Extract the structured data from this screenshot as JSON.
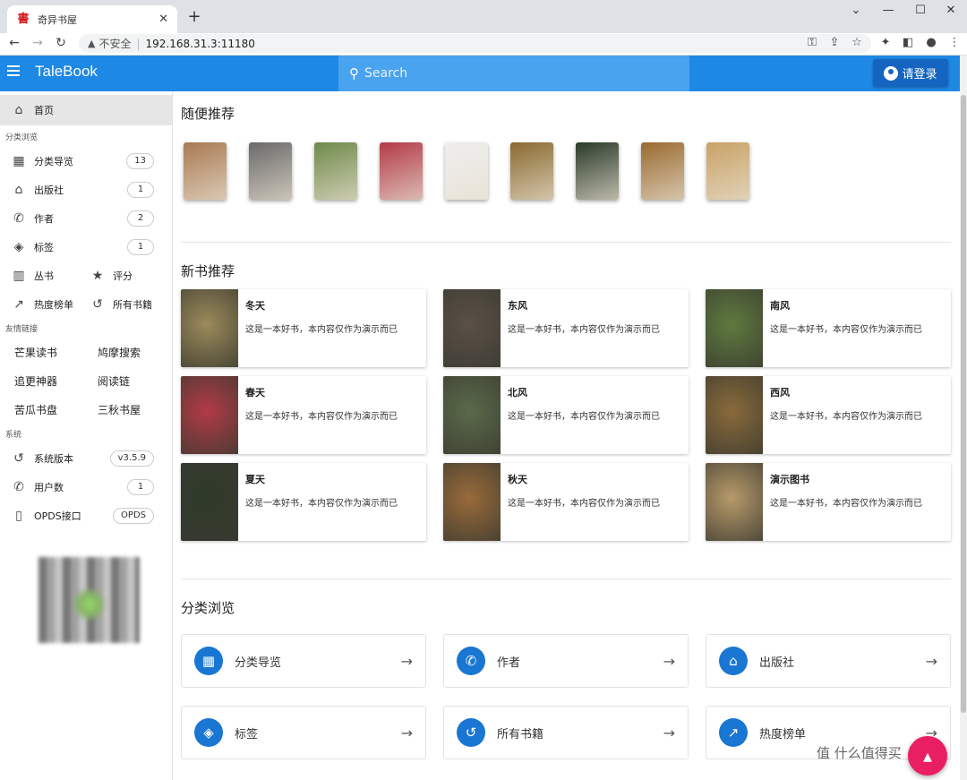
{
  "browser": {
    "tab_title": "奇异书屋",
    "favicon": "書",
    "address_warning": "不安全",
    "url": "192.168.31.3:11180"
  },
  "header": {
    "brand": "TaleBook",
    "search_placeholder": "Search",
    "login_label": "请登录"
  },
  "sidebar": {
    "home": "首页",
    "browse_heading": "分类浏览",
    "browse_items": [
      {
        "label": "分类导览",
        "count": "13",
        "icon": "grid-icon"
      },
      {
        "label": "出版社",
        "count": "1",
        "icon": "home-group-icon"
      },
      {
        "label": "作者",
        "count": "2",
        "icon": "person-icon"
      },
      {
        "label": "标签",
        "count": "1",
        "icon": "tag-icon"
      }
    ],
    "series": "丛书",
    "rating": "评分",
    "hot": "热度榜单",
    "all_books": "所有书籍",
    "links_heading": "友情链接",
    "links": [
      "芒果读书",
      "鸠摩搜索",
      "追更神器",
      "阅读链",
      "苦瓜书盘",
      "三秋书屋"
    ],
    "system_heading": "系统",
    "system_items": [
      {
        "label": "系统版本",
        "value": "v3.5.9",
        "icon": "history-icon"
      },
      {
        "label": "用户数",
        "value": "1",
        "icon": "person-icon"
      },
      {
        "label": "OPDS接口",
        "value": "OPDS",
        "icon": "phone-icon"
      }
    ]
  },
  "main": {
    "random_title": "随便推荐",
    "random_colors": [
      "#a97a52",
      "#6a6a6a",
      "#6f8a4a",
      "#b33a48",
      "#eeeeee",
      "#8a6a30",
      "#2a3a2a",
      "#9a6a30",
      "#c9a266"
    ],
    "new_title": "新书推荐",
    "books": [
      {
        "title": "冬天",
        "desc": "这是一本好书，本内容仅作为演示而已",
        "color": "#9c8a5a"
      },
      {
        "title": "东风",
        "desc": "这是一本好书，本内容仅作为演示而已",
        "color": "#5a5048"
      },
      {
        "title": "南风",
        "desc": "这是一本好书，本内容仅作为演示而已",
        "color": "#5e7a3e"
      },
      {
        "title": "春天",
        "desc": "这是一本好书，本内容仅作为演示而已",
        "color": "#b23a46"
      },
      {
        "title": "北风",
        "desc": "这是一本好书，本内容仅作为演示而已",
        "color": "#5a6a4a"
      },
      {
        "title": "西风",
        "desc": "这是一本好书，本内容仅作为演示而已",
        "color": "#8a6a3a"
      },
      {
        "title": "夏天",
        "desc": "这是一本好书，本内容仅作为演示而已",
        "color": "#2e3a2a"
      },
      {
        "title": "秋天",
        "desc": "这是一本好书，本内容仅作为演示而已",
        "color": "#9a6a3a"
      },
      {
        "title": "演示图书",
        "desc": "这是一本好书，本内容仅作为演示而已",
        "color": "#b89a6a"
      }
    ],
    "category_title": "分类浏览",
    "categories": [
      {
        "label": "分类导览",
        "icon": "grid-icon"
      },
      {
        "label": "作者",
        "icon": "person-icon"
      },
      {
        "label": "出版社",
        "icon": "home-group-icon"
      },
      {
        "label": "标签",
        "icon": "tag-icon"
      },
      {
        "label": "所有书籍",
        "icon": "history-icon"
      },
      {
        "label": "热度榜单",
        "icon": "trending-icon"
      }
    ]
  },
  "watermark": "值 什么值得买",
  "colors": {
    "primary": "#1e88e5",
    "dark": "#1565c0",
    "fab": "#e91e63"
  }
}
